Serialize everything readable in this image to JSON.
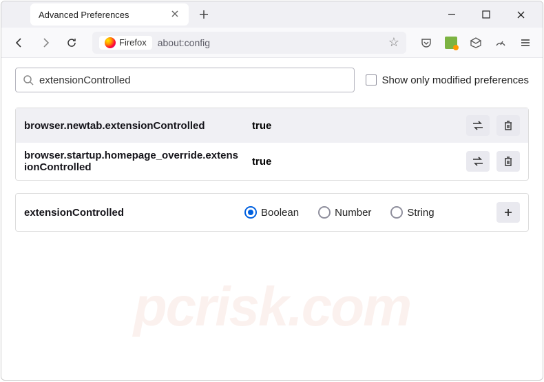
{
  "window": {
    "tab_title": "Advanced Preferences"
  },
  "urlbar": {
    "browser_label": "Firefox",
    "url": "about:config"
  },
  "search": {
    "value": "extensionControlled",
    "checkbox_label": "Show only modified preferences"
  },
  "prefs": [
    {
      "name": "browser.newtab.extensionControlled",
      "value": "true"
    },
    {
      "name": "browser.startup.homepage_override.extensionControlled",
      "value": "true"
    }
  ],
  "newpref": {
    "name": "extensionControlled",
    "types": [
      "Boolean",
      "Number",
      "String"
    ],
    "selected": 0
  },
  "watermark": "pcrisk.com"
}
